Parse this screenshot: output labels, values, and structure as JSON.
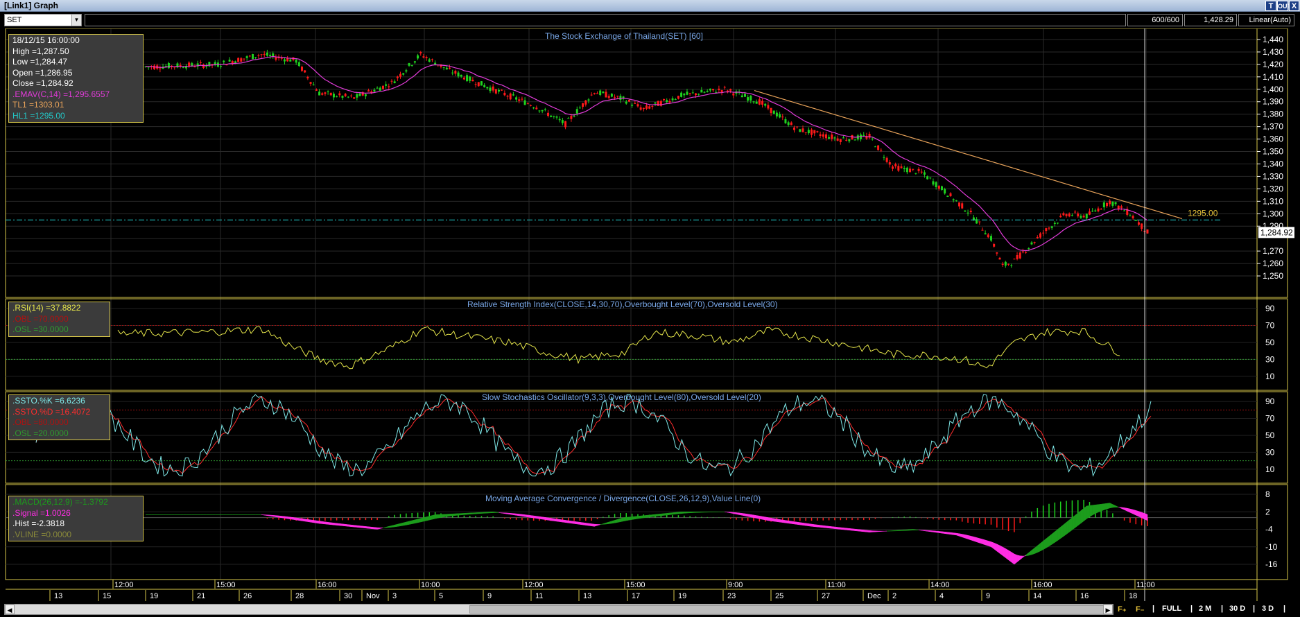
{
  "window": {
    "title": "[Link1] Graph",
    "buttons": [
      "T",
      "OUT",
      "X"
    ]
  },
  "toolbar": {
    "symbol": "SET",
    "bars": "600/600",
    "last": "1,428.29",
    "scale": "Linear(Auto)"
  },
  "panels": {
    "price": {
      "title": "The Stock Exchange of Thailand(SET) [60]",
      "info": [
        "18/12/15 16:00:00",
        "High  =1,287.50",
        "Low  =1,284.47",
        "Open  =1,286.95",
        "Close  =1,284.92",
        ".EMAV(C,14)  =1,295.6557",
        "TL1 =1303.01",
        "HL1 =1295.00"
      ],
      "hline_label": "1295.00",
      "last_tag": "1,284.92",
      "ylabels": [
        "1,440",
        "1,430",
        "1,420",
        "1,410",
        "1,400",
        "1,390",
        "1,380",
        "1,370",
        "1,360",
        "1,350",
        "1,340",
        "1,330",
        "1,320",
        "1,310",
        "1,300",
        "1,290",
        "1,270",
        "1,260",
        "1,250"
      ]
    },
    "rsi": {
      "title": "Relative Strength Index(CLOSE,14,30,70),Overbought Level(70),Oversold Level(30)",
      "info": [
        ".RSI(14)  =37.8822",
        ".OBL  =70.0000",
        ".OSL  =30.0000"
      ],
      "ylabels": [
        "90",
        "70",
        "50",
        "30",
        "10"
      ]
    },
    "stoch": {
      "title": "Slow Stochastics Oscillator(9,3,3),Overbought Level(80),Oversold Level(20)",
      "info": [
        ".SSTO.%K  =6.6236",
        ".SSTO.%D  =16.4072",
        ".OBL  =80.0000",
        ".OSL  =20.0000"
      ],
      "ylabels": [
        "90",
        "70",
        "50",
        "30",
        "10"
      ]
    },
    "macd": {
      "title": "Moving Average Convergence / Divergence(CLOSE,26,12,9),Value Line(0)",
      "info": [
        ".MACD(26,12,9)  =-1.3792",
        ".Signal  =1.0026",
        ".Hist  =-2.3818",
        ".VLINE  =0.0000"
      ],
      "ylabels": [
        "8",
        "2",
        "-4",
        "-10",
        "-16"
      ]
    }
  },
  "time_axis": [
    "12:00",
    "15:00",
    "16:00",
    "10:00",
    "12:00",
    "15:00",
    "9:00",
    "11:00",
    "14:00",
    "16:00",
    "11:00"
  ],
  "date_axis": [
    "13",
    "15",
    "19",
    "21",
    "26",
    "28",
    "30",
    "Nov",
    "3",
    "5",
    "9",
    "11",
    "13",
    "17",
    "19",
    "23",
    "25",
    "27",
    "Dec",
    "2",
    "4",
    "9",
    "14",
    "16",
    "18"
  ],
  "bottom_buttons": [
    "FULL",
    "2 M",
    "30 D",
    "3 D"
  ],
  "colors": {
    "up": "#1fd21f",
    "down": "#ff1a1a",
    "ema": "#e23bd9",
    "trend": "#e8a35a",
    "hline": "#23c8c8",
    "rsi": "#e6e64b",
    "stoch_k": "#7fe8e8",
    "stoch_d": "#ff2d2d",
    "macd_pos": "#1c9c1c",
    "macd_neg": "#ff2de4"
  }
}
